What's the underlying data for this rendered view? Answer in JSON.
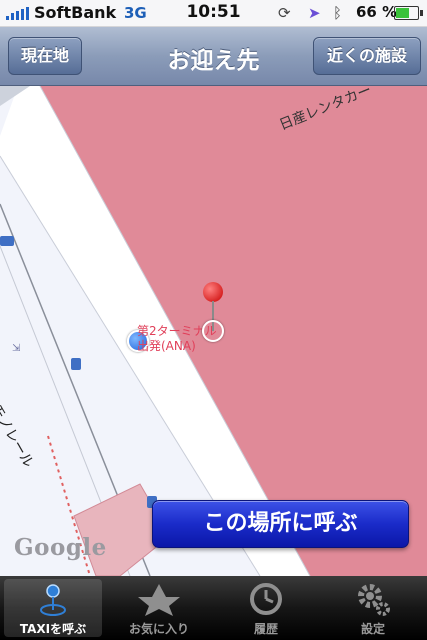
{
  "status": {
    "carrier": "SoftBank",
    "network": "3G",
    "time": "10:51",
    "battery_pct": "66 %",
    "battery_level": 0.66
  },
  "navbar": {
    "left_button": "現在地",
    "title": "お迎え先",
    "right_button": "近くの施設"
  },
  "map": {
    "area_label": "日産レンタカー",
    "pin_label_1": "第2ターミナル",
    "pin_label_2": "出発(ANA)",
    "line_label": "東京モノレール",
    "attribution": "Google",
    "call_button": "この場所に呼ぶ",
    "colors": {
      "zone": "#e08a98",
      "road": "#ffffff",
      "ground": "#f2f4fb"
    }
  },
  "tabs": [
    {
      "label": "TAXIを呼ぶ",
      "icon": "taxi-pin-icon",
      "active": true
    },
    {
      "label": "お気に入り",
      "icon": "star-icon",
      "active": false
    },
    {
      "label": "履歴",
      "icon": "clock-icon",
      "active": false
    },
    {
      "label": "設定",
      "icon": "gear-icon",
      "active": false
    }
  ]
}
